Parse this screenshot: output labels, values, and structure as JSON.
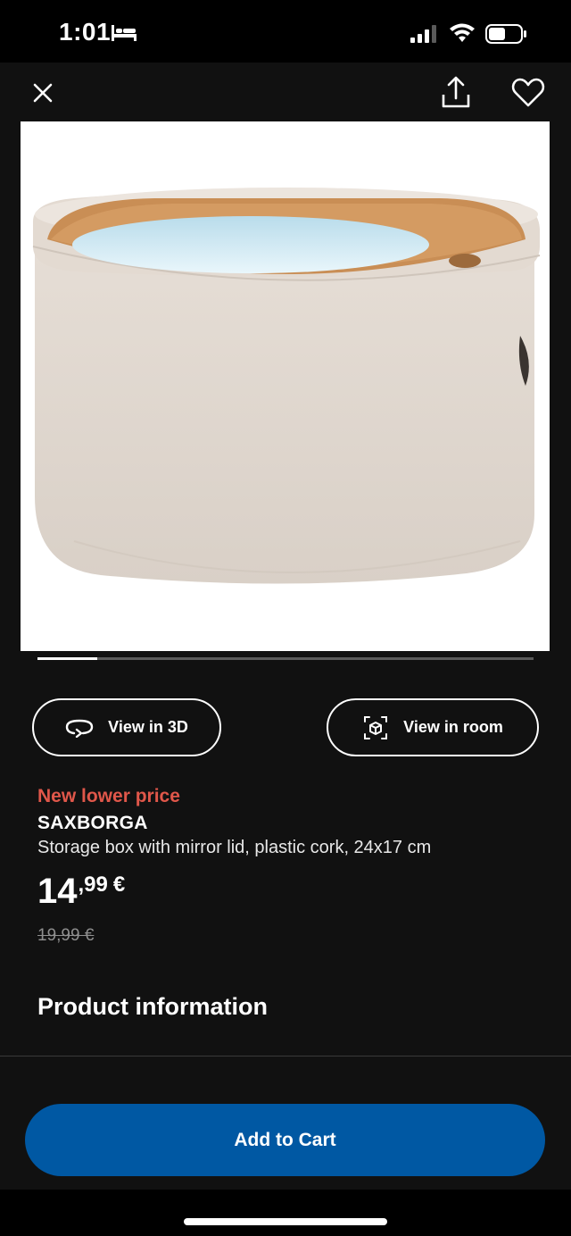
{
  "status_bar": {
    "time": "1:01",
    "icons": [
      "bed-icon",
      "signal-icon",
      "wifi-icon",
      "battery-icon"
    ]
  },
  "header": {
    "icons": [
      "close-icon",
      "share-icon",
      "heart-icon"
    ]
  },
  "gallery": {
    "image": "storage-box-mirror-lid-photo",
    "progress_fraction": 0.12
  },
  "actions": {
    "view_3d": {
      "label": "View in 3D",
      "icon": "rotate-3d-icon"
    },
    "view_room": {
      "label": "View in room",
      "icon": "ar-cube-icon"
    }
  },
  "product": {
    "promo": "New lower price",
    "name": "SAXBORGA",
    "description": "Storage box with mirror lid, plastic cork, 24x17 cm",
    "price_int": "14",
    "price_dec": ",99",
    "price_cur": "€",
    "old_price": "19,99 €"
  },
  "info": {
    "title": "Product information"
  },
  "cart": {
    "label": "Add to Cart"
  },
  "colors": {
    "background": "#111111",
    "promo": "#e0574a",
    "cart_button": "#0058a3"
  }
}
